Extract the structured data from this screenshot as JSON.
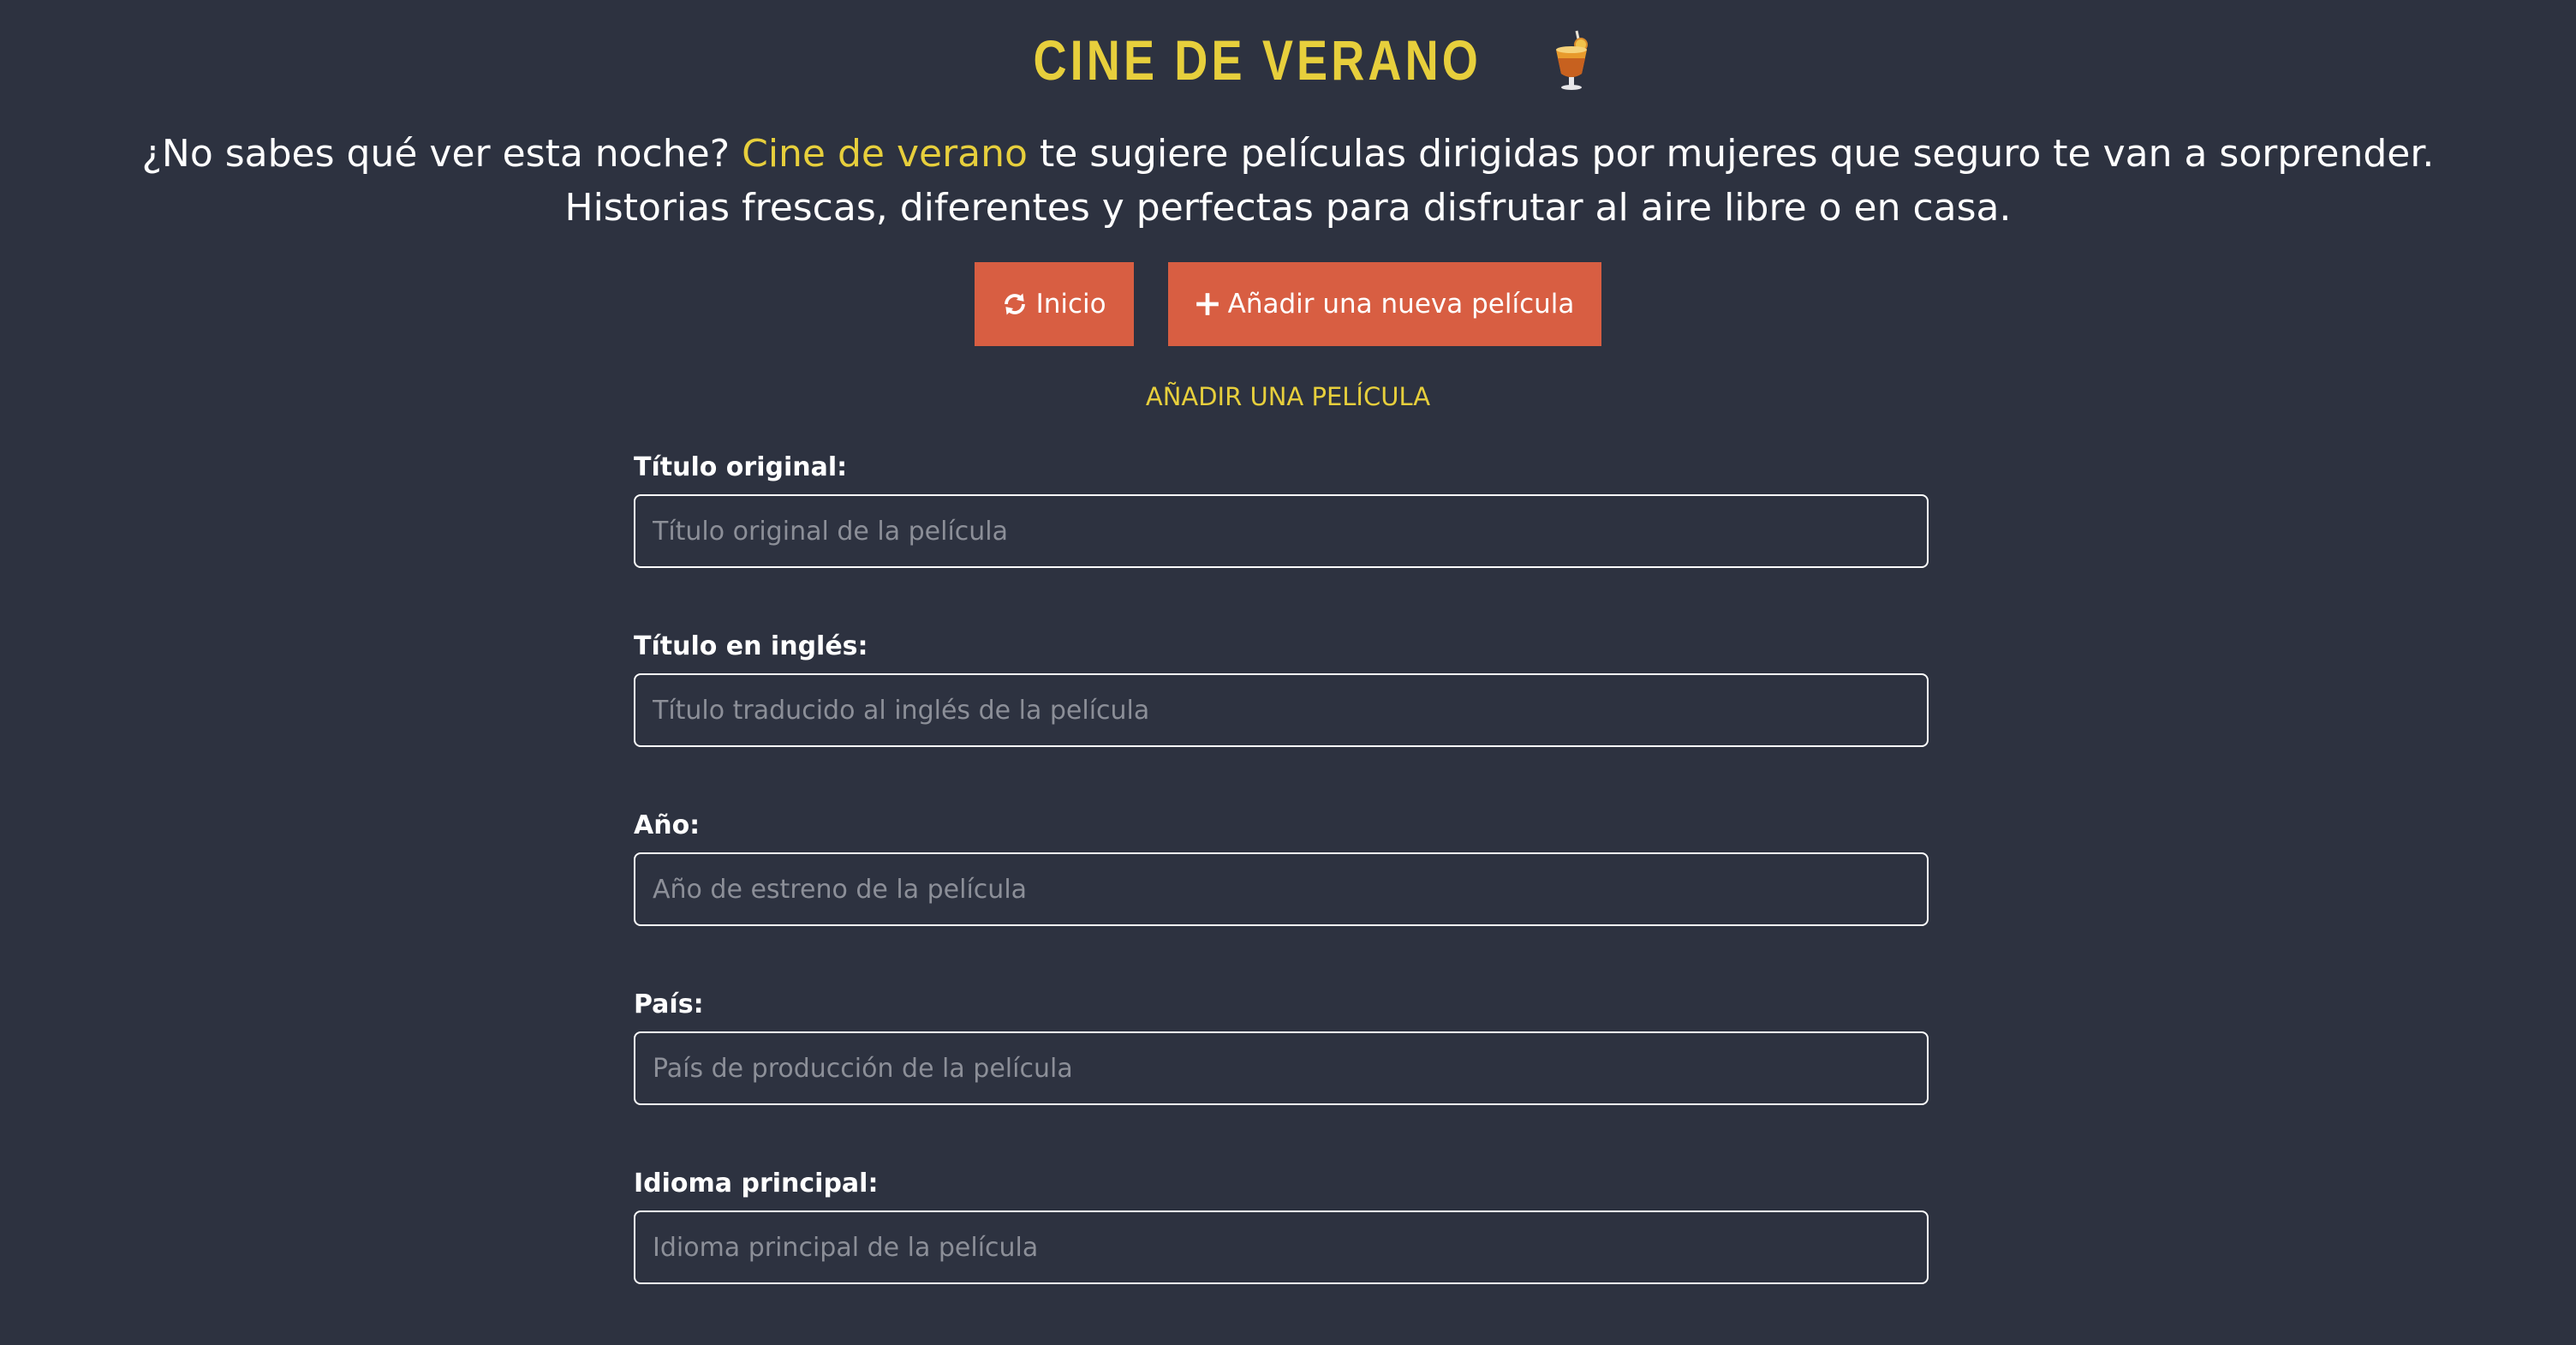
{
  "header": {
    "title": "CINE DE VERANO"
  },
  "intro": {
    "line1_before": "¿No sabes qué ver esta noche? ",
    "line1_highlight": "Cine de verano",
    "line1_after": " te sugiere películas dirigidas por mujeres que seguro te van a sorprender.",
    "line2": "Historias frescas, diferentes y perfectas para disfrutar al aire libre o en casa."
  },
  "buttons": {
    "home": {
      "label": "Inicio",
      "icon": "refresh-icon"
    },
    "add": {
      "label": "Añadir una nueva película",
      "icon": "plus-icon"
    }
  },
  "form": {
    "heading": "AÑADIR UNA PELÍCULA",
    "fields": [
      {
        "label": "Título original:",
        "placeholder": "Título original de la película",
        "value": ""
      },
      {
        "label": "Título en inglés:",
        "placeholder": "Título traducido al inglés de la película",
        "value": ""
      },
      {
        "label": "Año:",
        "placeholder": "Año de estreno de la película",
        "value": ""
      },
      {
        "label": "País:",
        "placeholder": "País de producción de la película",
        "value": ""
      },
      {
        "label": "Idioma principal:",
        "placeholder": "Idioma principal de la película",
        "value": ""
      }
    ]
  },
  "colors": {
    "background": "#2d3240",
    "accent": "#e7cf3c",
    "button": "#d85e42",
    "text": "#ffffff",
    "placeholder": "#8c8f98"
  }
}
